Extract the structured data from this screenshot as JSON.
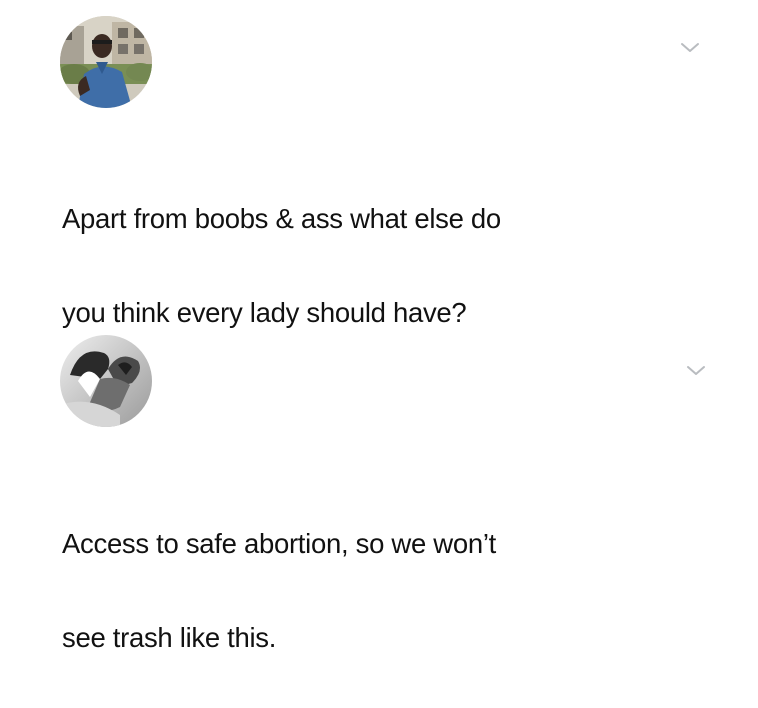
{
  "tweets": [
    {
      "avatar_icon": "user-avatar-photo",
      "menu_icon": "chevron-down-icon",
      "text_lines": [
        "Apart from boobs & ass what else do",
        "you think every lady should have?"
      ]
    },
    {
      "avatar_icon": "user-avatar-photo",
      "menu_icon": "chevron-down-icon",
      "text_lines": [
        "Access to safe abortion, so we won’t",
        "see trash like this."
      ]
    }
  ],
  "colors": {
    "background": "#ffffff",
    "text": "#111111",
    "chevron": "#b9bcc0"
  }
}
